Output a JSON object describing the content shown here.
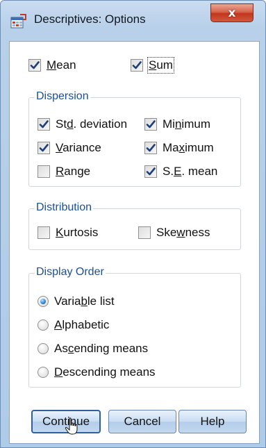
{
  "window": {
    "title": "Descriptives: Options",
    "close_label": "x"
  },
  "top_options": [
    {
      "label_pre": "",
      "label_u": "M",
      "label_post": "ean",
      "checked": true
    },
    {
      "label_pre": "",
      "label_u": "S",
      "label_post": "um",
      "checked": true
    }
  ],
  "dispersion": {
    "legend": "Dispersion",
    "items": [
      {
        "label_pre": "St",
        "label_u": "d",
        "label_post": ". deviation",
        "checked": true
      },
      {
        "label_pre": "Mi",
        "label_u": "n",
        "label_post": "imum",
        "checked": true
      },
      {
        "label_pre": "",
        "label_u": "V",
        "label_post": "ariance",
        "checked": true
      },
      {
        "label_pre": "Ma",
        "label_u": "x",
        "label_post": "imum",
        "checked": true
      },
      {
        "label_pre": "",
        "label_u": "R",
        "label_post": "ange",
        "checked": false
      },
      {
        "label_pre": "S.",
        "label_u": "E",
        "label_post": ". mean",
        "checked": true
      }
    ]
  },
  "distribution": {
    "legend": "Distribution",
    "items": [
      {
        "label_pre": "",
        "label_u": "K",
        "label_post": "urtosis",
        "checked": false
      },
      {
        "label_pre": "Ske",
        "label_u": "w",
        "label_post": "ness",
        "checked": false
      }
    ]
  },
  "display_order": {
    "legend": "Display Order",
    "items": [
      {
        "label_pre": "Varia",
        "label_u": "b",
        "label_post": "le list",
        "selected": true
      },
      {
        "label_pre": "",
        "label_u": "A",
        "label_post": "lphabetic",
        "selected": false
      },
      {
        "label_pre": "As",
        "label_u": "c",
        "label_post": "ending means",
        "selected": false
      },
      {
        "label_pre": "",
        "label_u": "D",
        "label_post": "escending means",
        "selected": false
      }
    ]
  },
  "buttons": {
    "continue_label": "Continue",
    "cancel_label": "Cancel",
    "help_label": "Help"
  },
  "colors": {
    "check": "#1f3f7a",
    "legend_text": "#1a4f9a",
    "radio_selected": "#2a84d4"
  }
}
